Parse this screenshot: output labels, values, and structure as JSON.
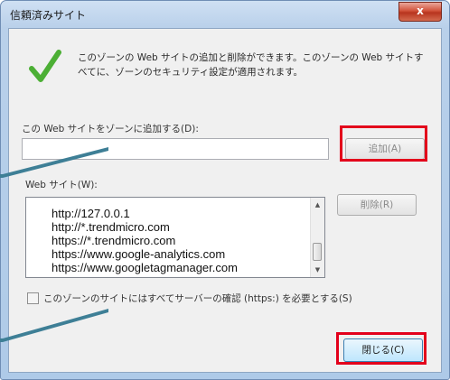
{
  "window": {
    "title": "信頼済みサイト",
    "close_label": "x"
  },
  "description": "このゾーンの Web サイトの追加と削除ができます。このゾーンの Web サイトすべてに、ゾーンのセキュリティ設定が適用されます。",
  "add_section": {
    "label": "この Web サイトをゾーンに追加する(D):",
    "input_value": "",
    "add_button": "追加(A)"
  },
  "sites_section": {
    "label": "Web サイト(W):",
    "items": [
      "http://127.0.0.1",
      "http://*.trendmicro.com",
      "https://*.trendmicro.com",
      "https://www.google-analytics.com",
      "https://www.googletagmanager.com"
    ],
    "remove_button": "削除(R)"
  },
  "https_checkbox": {
    "label": "このゾーンのサイトにはすべてサーバーの確認 (https:) を必要とする(S)",
    "checked": false
  },
  "close_button": "閉じる(C)",
  "colors": {
    "highlight": "#e3001b",
    "callout_line": "#3e7f96",
    "check_green": "#4caf35"
  }
}
